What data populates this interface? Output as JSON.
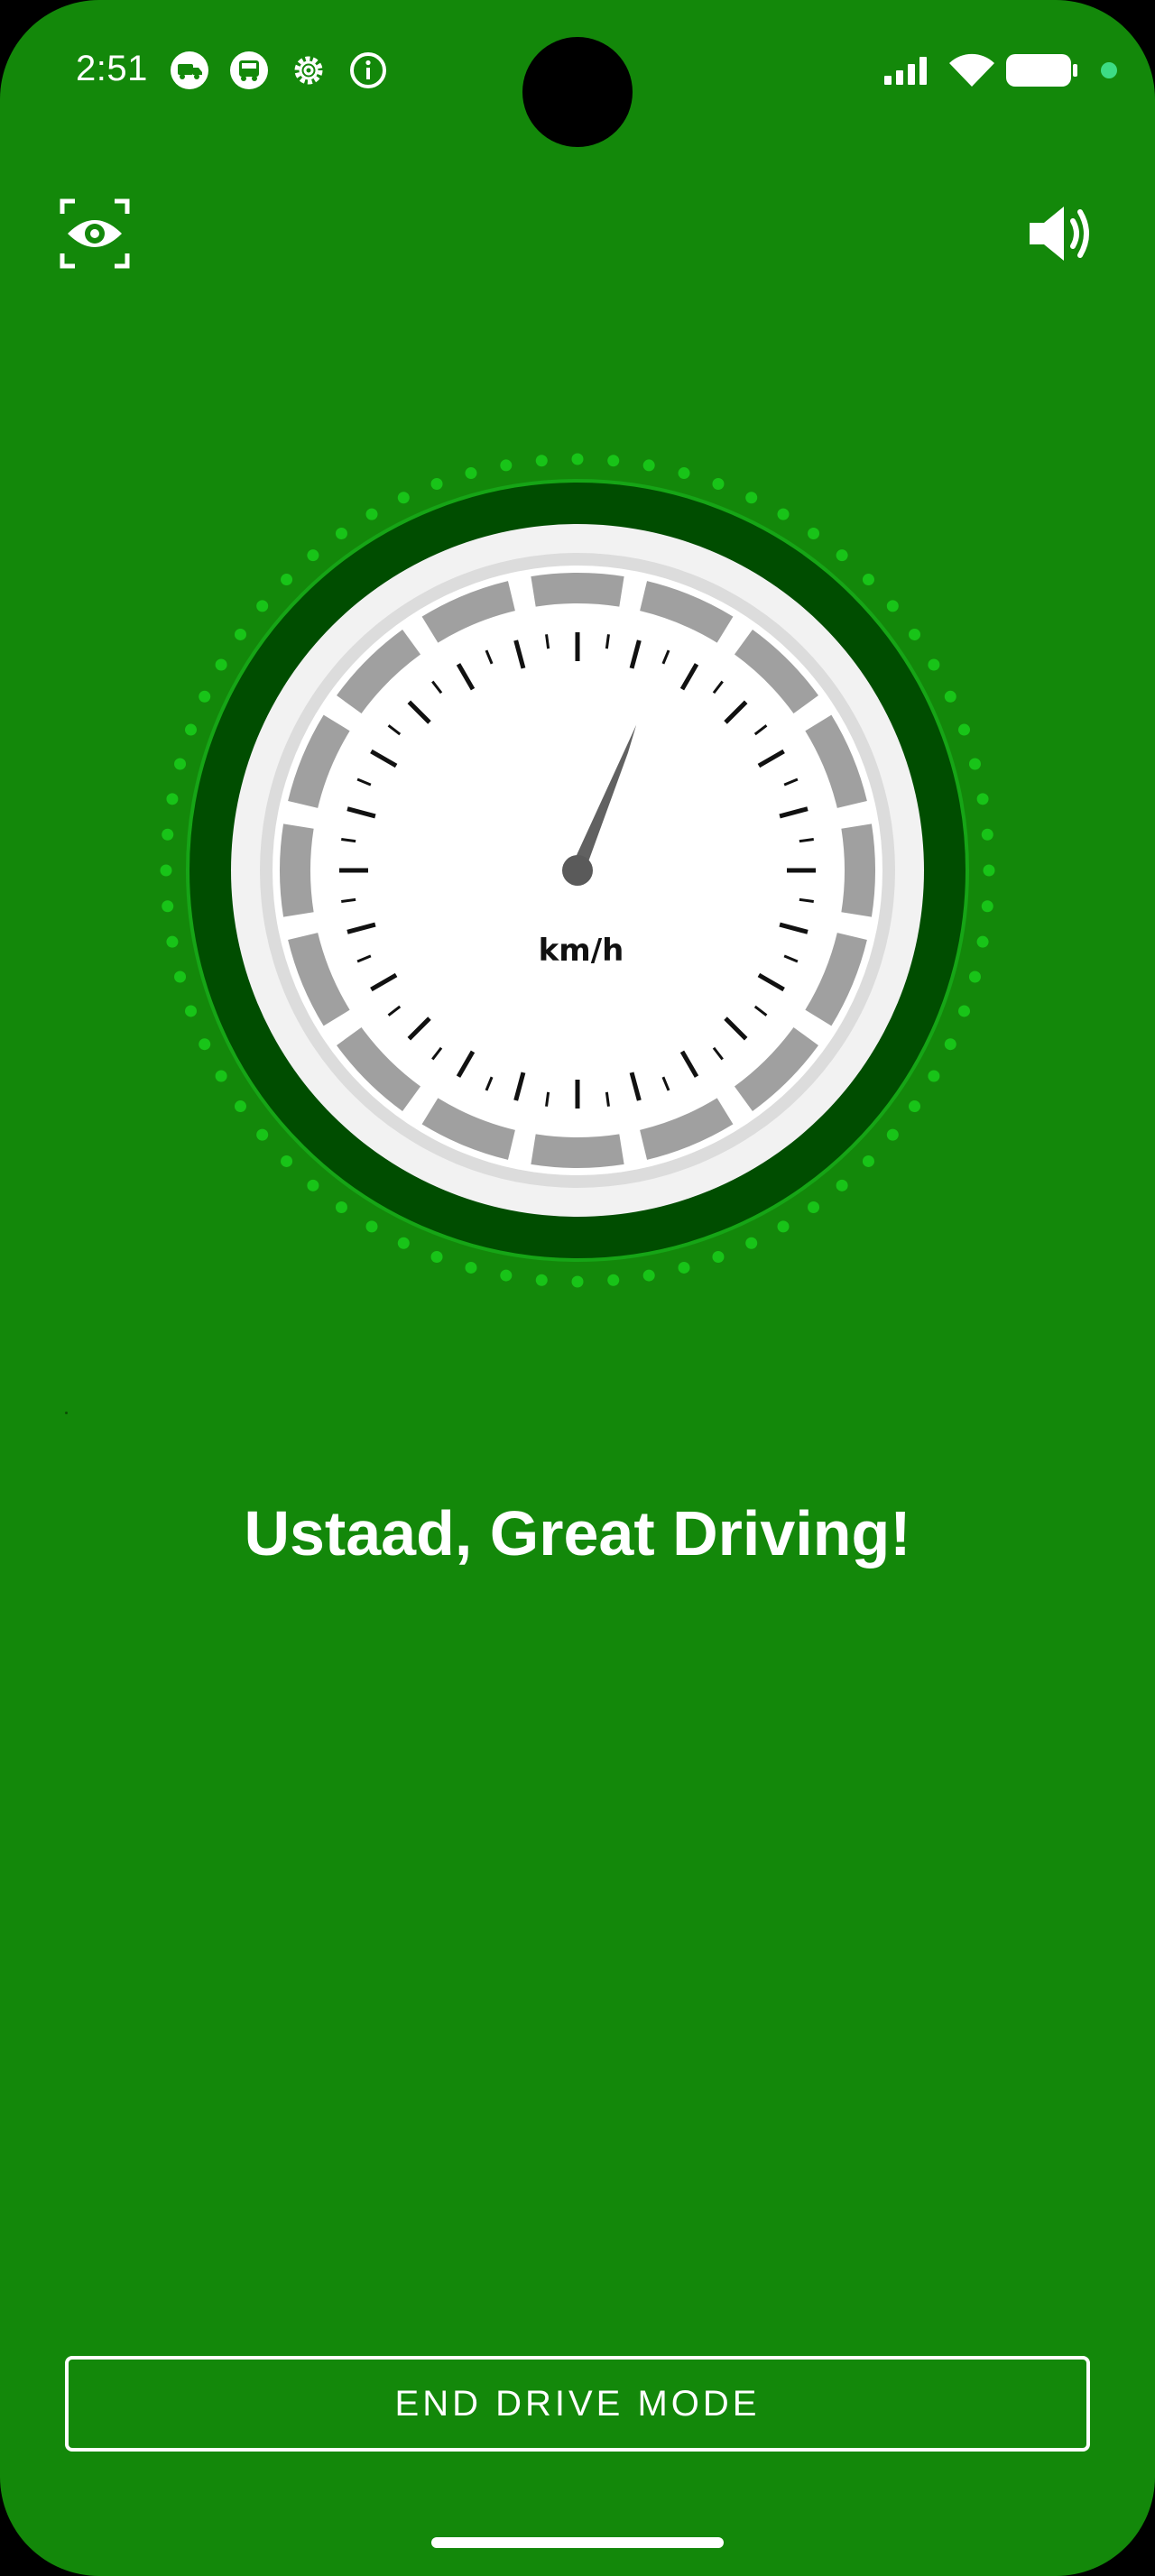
{
  "status_bar": {
    "time": "2:51",
    "notification_icons": [
      "truck-badge-icon",
      "bus-badge-icon",
      "settings-gear-icon",
      "info-icon"
    ],
    "system_icons": [
      "signal-bars-icon",
      "wifi-icon",
      "battery-icon",
      "status-dot-icon"
    ]
  },
  "top_actions": {
    "left_icon": "eye-scan-icon",
    "right_icon": "speaker-volume-icon"
  },
  "speedometer": {
    "unit_label": "km/h",
    "needle_angle_deg": 22,
    "colors": {
      "outer_ring": "#004d00",
      "dot_ring": "#18c418",
      "face": "#ffffff",
      "segments": "#a0a0a0",
      "needle": "#616161"
    }
  },
  "message": "Ustaad, Great Driving!",
  "end_button_label": "END DRIVE MODE",
  "colors": {
    "background": "#13880a",
    "text": "#ffffff"
  }
}
